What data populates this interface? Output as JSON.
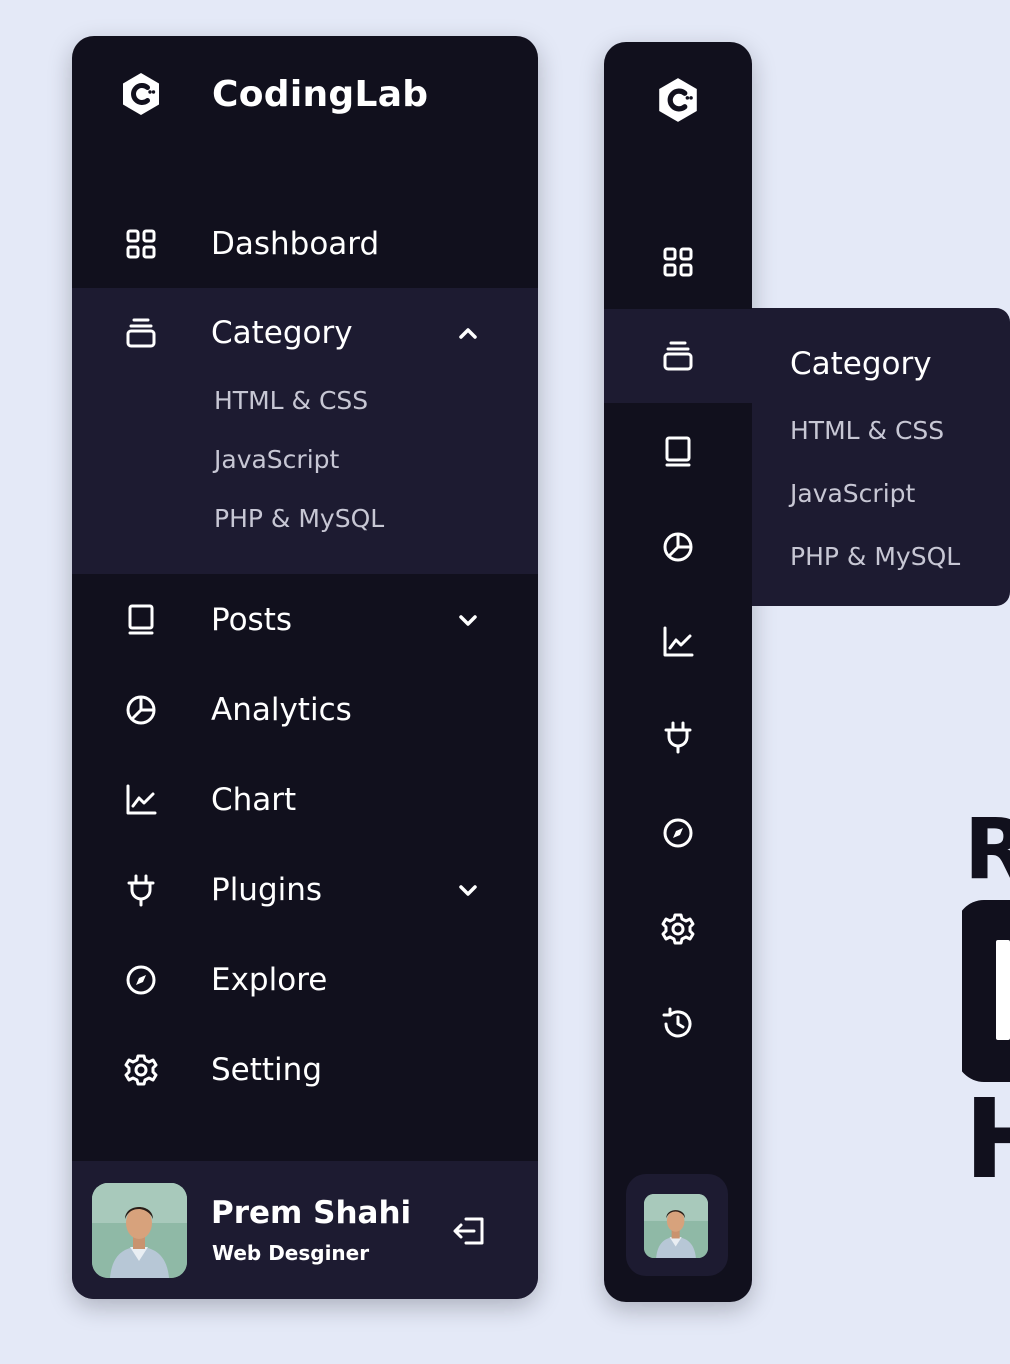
{
  "brand": {
    "name": "CodingLab",
    "logo_icon": "c-hexagon-logo-icon"
  },
  "sidebar": {
    "menu": [
      {
        "label": "Dashboard",
        "icon": "grid-icon"
      },
      {
        "label": "Category",
        "icon": "collection-icon",
        "expanded": true,
        "sub_items": [
          "HTML & CSS",
          "JavaScript",
          "PHP & MySQL"
        ]
      },
      {
        "label": "Posts",
        "icon": "book-icon",
        "has_arrow": true
      },
      {
        "label": "Analytics",
        "icon": "pie-chart-icon"
      },
      {
        "label": "Chart",
        "icon": "line-chart-icon"
      },
      {
        "label": "Plugins",
        "icon": "plug-icon",
        "has_arrow": true
      },
      {
        "label": "Explore",
        "icon": "compass-icon"
      },
      {
        "label": "Setting",
        "icon": "gear-icon"
      }
    ]
  },
  "profile": {
    "name": "Prem Shahi",
    "job": "Web Desginer",
    "logout_icon": "log-out-icon"
  },
  "mini_sidebar": {
    "icons": [
      "grid-icon",
      "collection-icon",
      "book-icon",
      "pie-chart-icon",
      "line-chart-icon",
      "plug-icon",
      "compass-icon",
      "gear-icon",
      "history-icon"
    ],
    "active_index": 1,
    "flyout": {
      "title": "Category",
      "sub_items": [
        "HTML & CSS",
        "JavaScript",
        "PHP & MySQL"
      ]
    }
  },
  "background_heading": {
    "line1": "R",
    "line3": "H"
  },
  "colors": {
    "sidebar": "#11101d",
    "active": "#1d1b31",
    "page": "#e4e9f7",
    "text": "#ffffff",
    "subtext": "#c7c7d4"
  }
}
